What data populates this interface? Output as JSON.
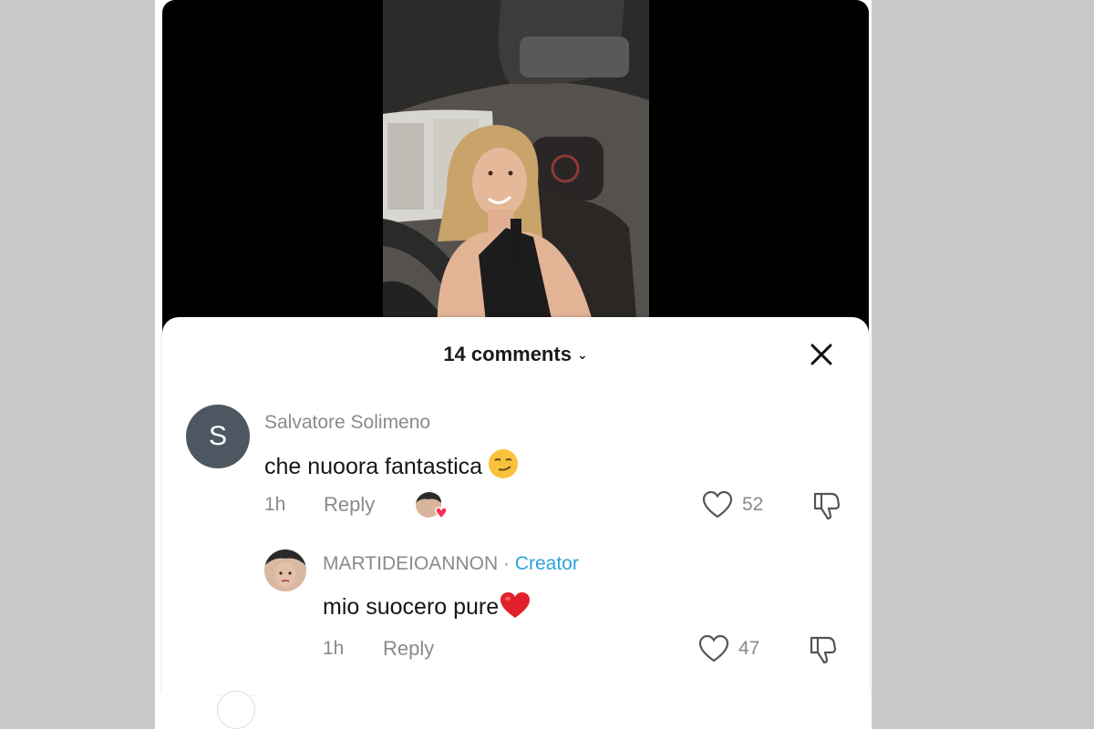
{
  "sheet": {
    "comment_count_label": "14 comments"
  },
  "comments": [
    {
      "avatar_letter": "S",
      "username": "Salvatore Solimeno",
      "text": "che nuoora fantastica",
      "time": "1h",
      "reply_label": "Reply",
      "likes": "52"
    }
  ],
  "replies": [
    {
      "username": "MARTIDEIOANNON",
      "separator": " · ",
      "badge": "Creator",
      "text": "mio suocero pure",
      "time": "1h",
      "reply_label": "Reply",
      "likes": "47"
    }
  ],
  "colors": {
    "creator_badge": "#2aa4d8",
    "liked_heart_badge": "#ff2d55",
    "muted_text": "#8a8a8a"
  },
  "icons": [
    "close-icon",
    "chevron-down-icon",
    "heart-outline-icon",
    "thumbs-down-icon",
    "creator-liked-avatar-icon"
  ]
}
